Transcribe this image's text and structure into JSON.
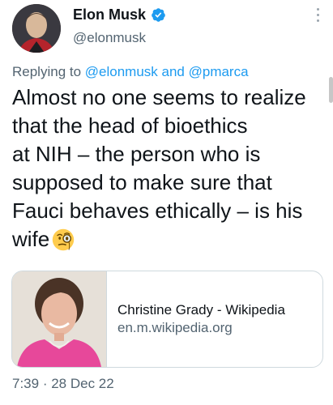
{
  "author": {
    "display_name": "Elon Musk",
    "handle": "@elonmusk",
    "verified": true
  },
  "reply_context": {
    "prefix": "Replying to ",
    "mention1": "@elonmusk",
    "joiner": " and ",
    "mention2": "@pmarca"
  },
  "tweet": {
    "line1": "Almost no one seems to realize",
    "line2": "that the head of bioethics",
    "line3": "at NIH – the person who is",
    "line4": "supposed to make sure that",
    "line5": "Fauci behaves ethically – is his",
    "line6": "wife",
    "emoji": "face-with-monocle-emoji"
  },
  "link_card": {
    "title": "Christine Grady - Wikipedia",
    "domain": "en.m.wikipedia.org"
  },
  "meta": {
    "time": "7:39",
    "separator": " · ",
    "date": "28 Dec 22"
  },
  "colors": {
    "link": "#1d9bf0",
    "secondary_text": "#536471",
    "primary_text": "#0f1419",
    "verified_badge": "#1d9bf0",
    "card_border": "#cfd9de"
  }
}
